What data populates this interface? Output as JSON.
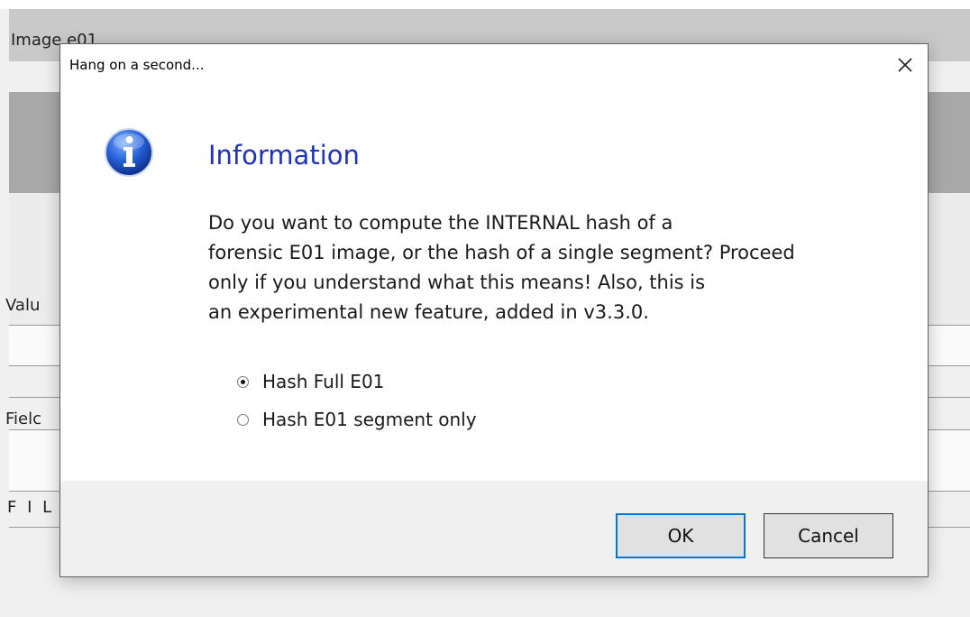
{
  "background": {
    "title": "Image e01",
    "labels": [
      "Valu",
      "Fielc",
      "F I L"
    ]
  },
  "dialog": {
    "title": "Hang on a second...",
    "heading": "Information",
    "message_lines": [
      "Do you want to compute the INTERNAL hash of a",
      "forensic E01 image, or the hash of a single segment? Proceed",
      "only if you understand what this means! Also, this is",
      "an experimental new feature, added in v3.3.0."
    ],
    "options": [
      {
        "label": "Hash Full E01",
        "checked": true
      },
      {
        "label": "Hash E01 segment only",
        "checked": false
      }
    ],
    "ok_label": "OK",
    "cancel_label": "Cancel"
  },
  "icons": {
    "info": "info-icon",
    "close": "close-icon"
  },
  "colors": {
    "heading": "#2233bb",
    "default_button_border": "#0078d7"
  }
}
